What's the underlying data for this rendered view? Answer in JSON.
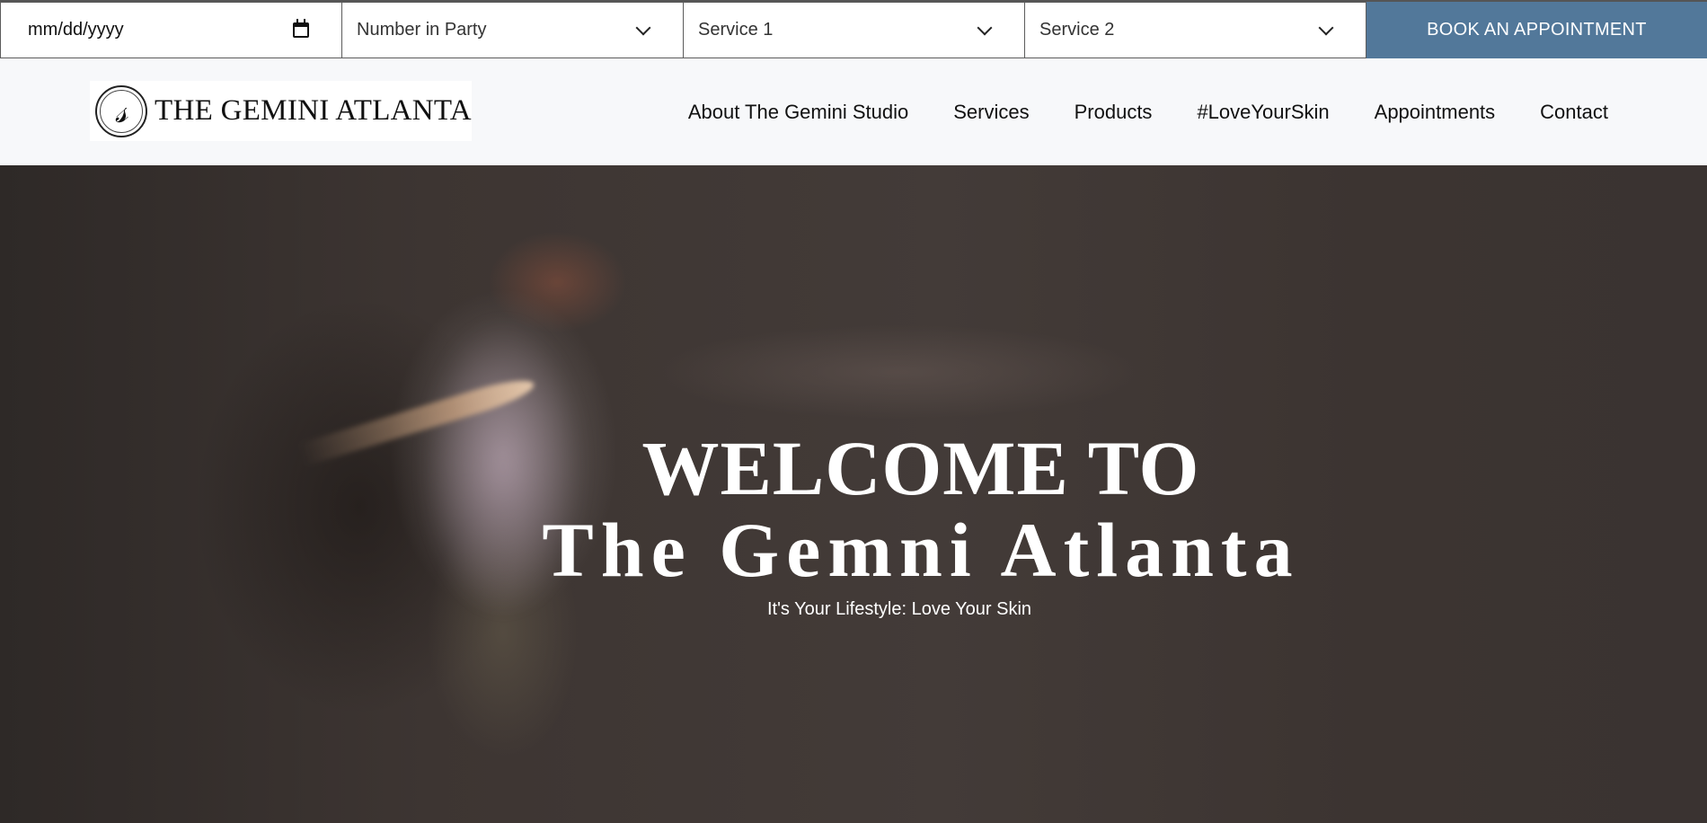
{
  "booking": {
    "date_placeholder": "mm/dd/yyyy",
    "party_label": "Number in Party",
    "service1_label": "Service 1",
    "service2_label": "Service 2",
    "book_button": "BOOK AN APPOINTMENT"
  },
  "header": {
    "logo_text": "THE GEMINI ATLANTA",
    "nav": [
      "About The Gemini Studio",
      "Services",
      "Products",
      "#LoveYourSkin",
      "Appointments",
      "Contact"
    ]
  },
  "hero": {
    "title_line1": "WELCOME TO",
    "title_line2": "The Gemni Atlanta",
    "tagline": "It's Your Lifestyle: Love Your Skin"
  },
  "colors": {
    "book_button_bg": "#52789a",
    "header_bg": "#f7f8fa",
    "hero_bg": "#3a3431"
  },
  "icons": {
    "date_field": "calendar-icon",
    "dropdowns": "chevron-down-icon",
    "logo": "gs-monogram-seal"
  }
}
